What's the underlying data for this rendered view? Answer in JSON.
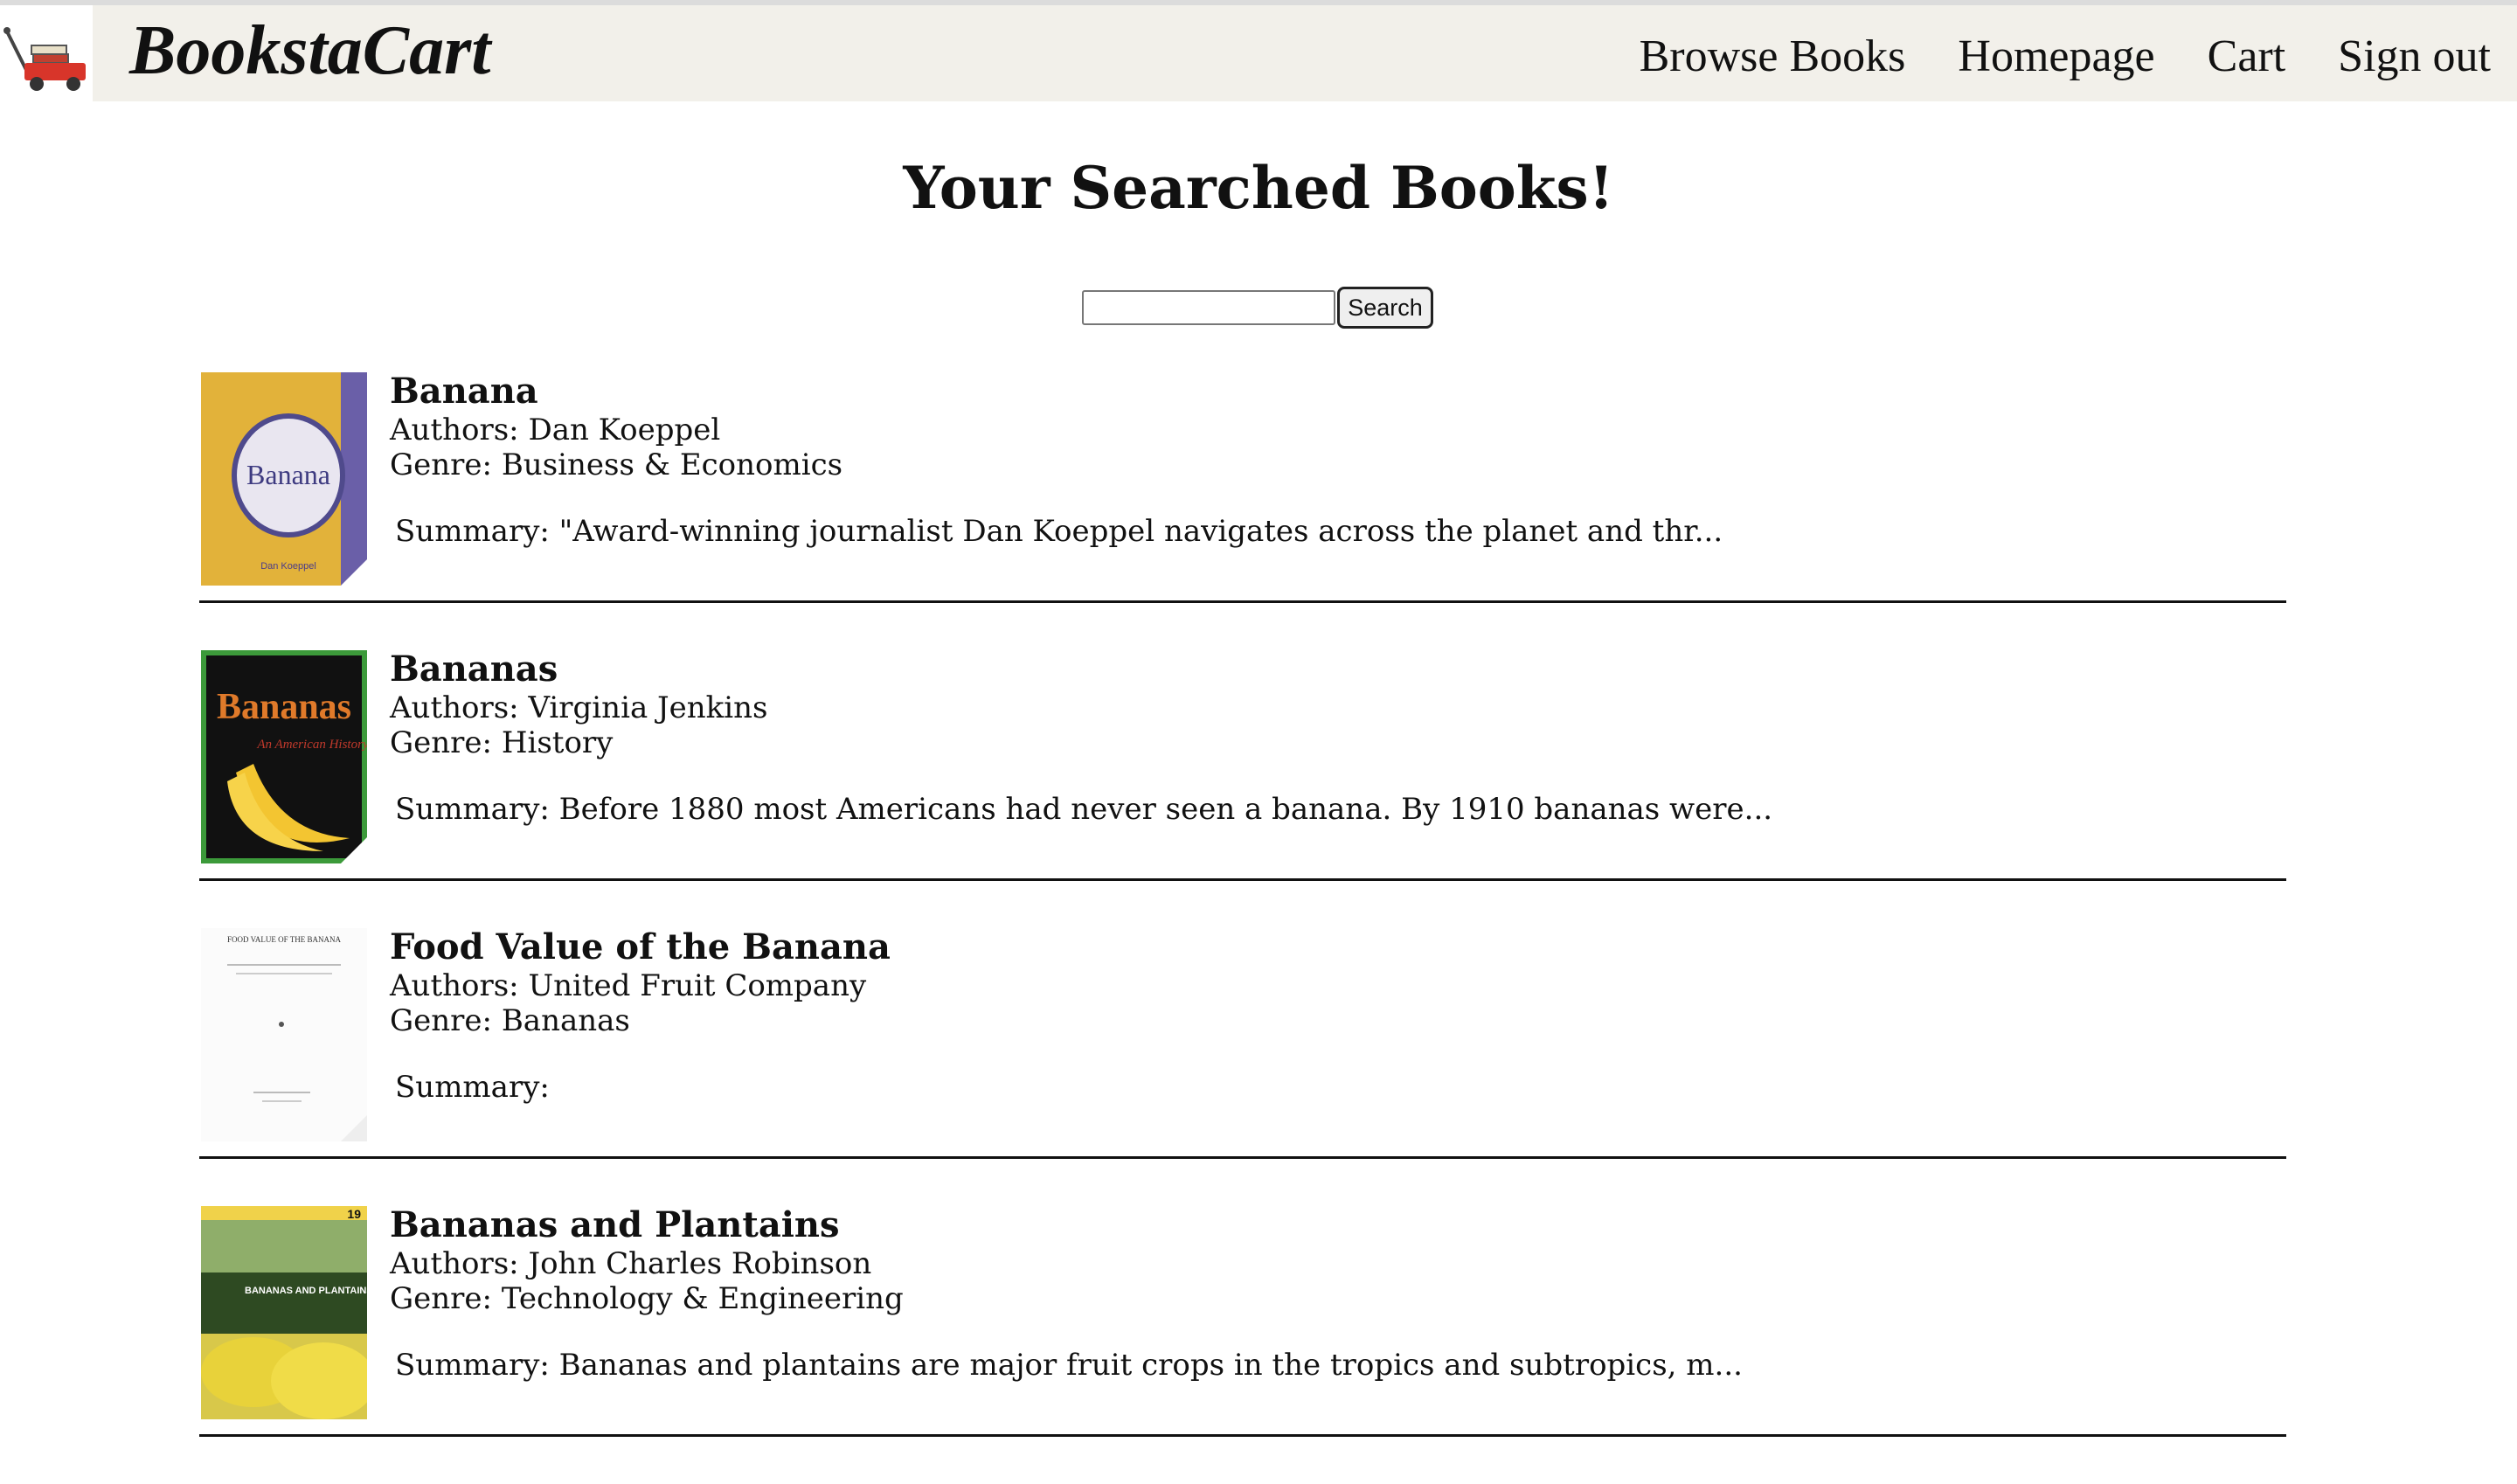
{
  "header": {
    "brand": "BookstaCart",
    "nav": [
      "Browse Books",
      "Homepage",
      "Cart",
      "Sign out"
    ]
  },
  "page": {
    "title": "Your Searched Books!",
    "search_value": "",
    "search_button": "Search"
  },
  "books": [
    {
      "title": "Banana",
      "authors": "Authors: Dan Koeppel",
      "genre": "Genre: Business & Economics",
      "summary": "Summary: \"Award-winning journalist Dan Koeppel navigates across the planet and thr...",
      "cover_text": "Banana",
      "cover_author": "Dan Koeppel"
    },
    {
      "title": "Bananas",
      "authors": "Authors: Virginia Jenkins",
      "genre": "Genre: History",
      "summary": "Summary: Before 1880 most Americans had never seen a banana. By 1910 bananas were...",
      "cover_text": "Bananas",
      "cover_subtitle": "An American History"
    },
    {
      "title": "Food Value of the Banana",
      "authors": "Authors: United Fruit Company",
      "genre": "Genre: Bananas",
      "summary": "Summary:",
      "cover_text": "FOOD VALUE OF THE BANANA"
    },
    {
      "title": "Bananas and Plantains",
      "authors": "Authors: John Charles Robinson",
      "genre": "Genre: Technology & Engineering",
      "summary": "Summary: Bananas and plantains are major fruit crops in the tropics and subtropics, m...",
      "cover_text": "BANANAS AND PLANTAINS",
      "cover_number": "19"
    }
  ]
}
